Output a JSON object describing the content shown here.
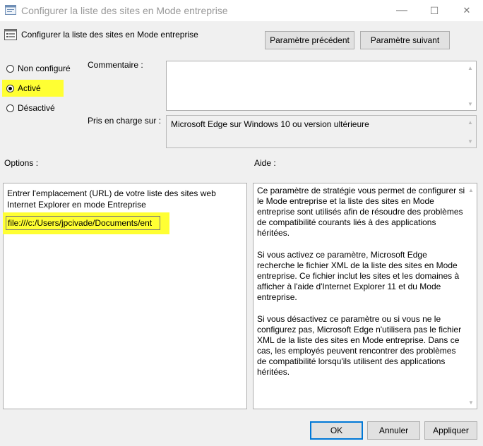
{
  "window": {
    "title": "Configurer la liste des sites en Mode entreprise",
    "minimize": "—",
    "maximize": "☐",
    "close": "✕"
  },
  "header": {
    "title": "Configurer la liste des sites en Mode entreprise",
    "prev_button": "Paramètre précédent",
    "next_button": "Paramètre suivant"
  },
  "state": {
    "options": [
      {
        "label": "Non configuré",
        "selected": false
      },
      {
        "label": "Activé",
        "selected": true
      },
      {
        "label": "Désactivé",
        "selected": false
      }
    ]
  },
  "comment": {
    "label": "Commentaire :",
    "value": ""
  },
  "supported": {
    "label": "Pris en charge sur :",
    "value": "Microsoft Edge sur Windows 10 ou version ultérieure"
  },
  "options_panel": {
    "label": "Options :",
    "description": "Entrer l'emplacement (URL) de votre liste des sites web Internet Explorer en mode Entreprise",
    "url_value": "file:///c:/Users/jpcivade/Documents/ent"
  },
  "help_panel": {
    "label": "Aide :",
    "paragraphs": [
      "Ce paramètre de stratégie vous permet de configurer si le Mode entreprise et la liste des sites en Mode entreprise sont utilisés afin de résoudre des problèmes de compatibilité courants liés à des applications héritées.",
      "Si vous activez ce paramètre, Microsoft Edge recherche le fichier XML de la liste des sites en Mode entreprise. Ce fichier inclut les sites et les domaines à afficher à l'aide d'Internet Explorer 11 et du Mode entreprise.",
      "Si vous désactivez ce paramètre ou si vous ne le configurez pas, Microsoft Edge n'utilisera pas le fichier XML de la liste des sites en Mode entreprise. Dans ce cas, les employés peuvent rencontrer des problèmes de compatibilité lorsqu'ils utilisent des applications héritées."
    ]
  },
  "footer": {
    "ok": "OK",
    "cancel": "Annuler",
    "apply": "Appliquer"
  },
  "colors": {
    "highlight": "#ffff33",
    "accent": "#0078d7"
  }
}
